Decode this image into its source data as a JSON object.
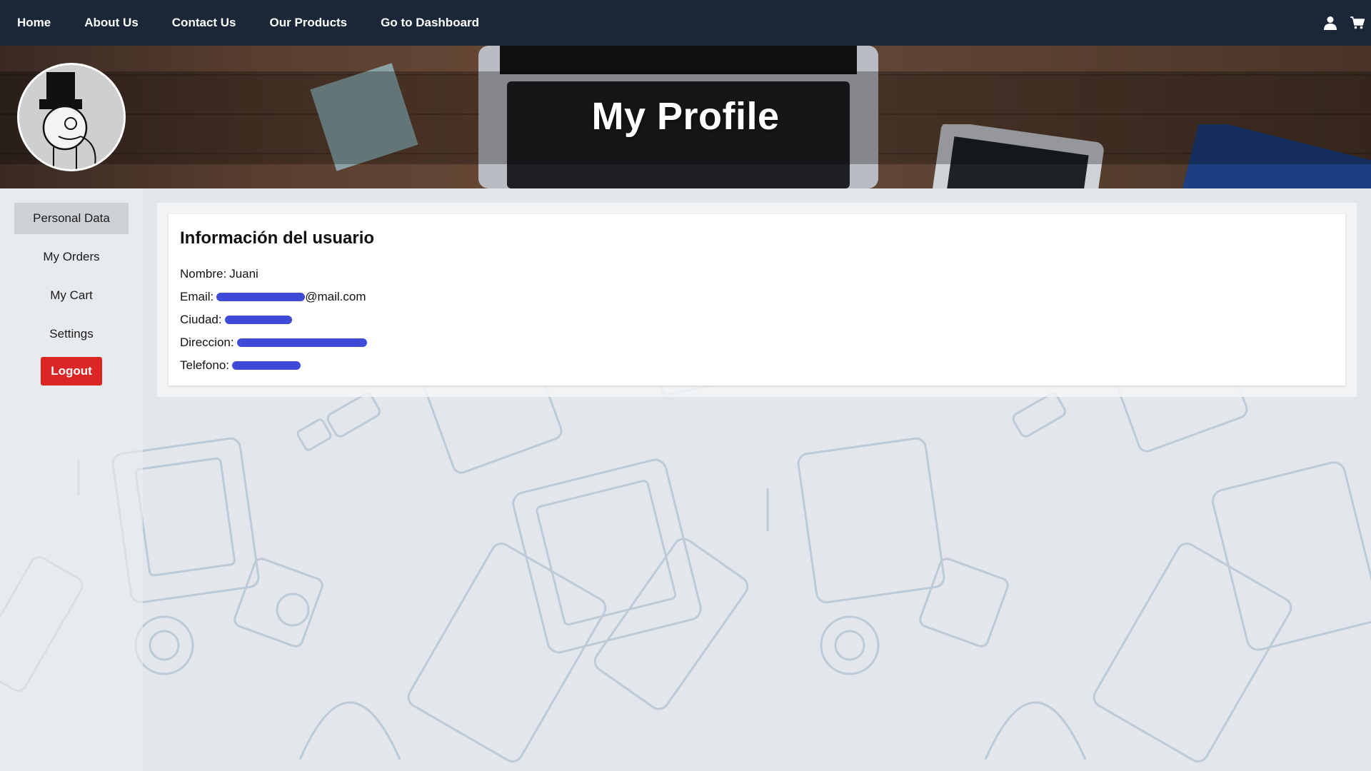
{
  "nav": {
    "links": [
      "Home",
      "About Us",
      "Contact Us",
      "Our Products",
      "Go to Dashboard"
    ],
    "icons": [
      "user-icon",
      "cart-icon"
    ]
  },
  "banner": {
    "title": "My Profile"
  },
  "sidebar": {
    "items": [
      {
        "label": "Personal Data",
        "active": true
      },
      {
        "label": "My Orders",
        "active": false
      },
      {
        "label": "My Cart",
        "active": false
      },
      {
        "label": "Settings",
        "active": false
      }
    ],
    "logout_label": "Logout",
    "logout_color": "#dc2626"
  },
  "user_info": {
    "title": "Información del usuario",
    "nombre_label": "Nombre:",
    "nombre_value": "Juani",
    "email_label": "Email:",
    "email_suffix": "@mail.com",
    "ciudad_label": "Ciudad:",
    "direccion_label": "Direccion:",
    "telefono_label": "Telefono:"
  },
  "colors": {
    "navbar": "#1c2639",
    "redaction": "#3e4bd6",
    "active_item": "#cfd2d5"
  }
}
